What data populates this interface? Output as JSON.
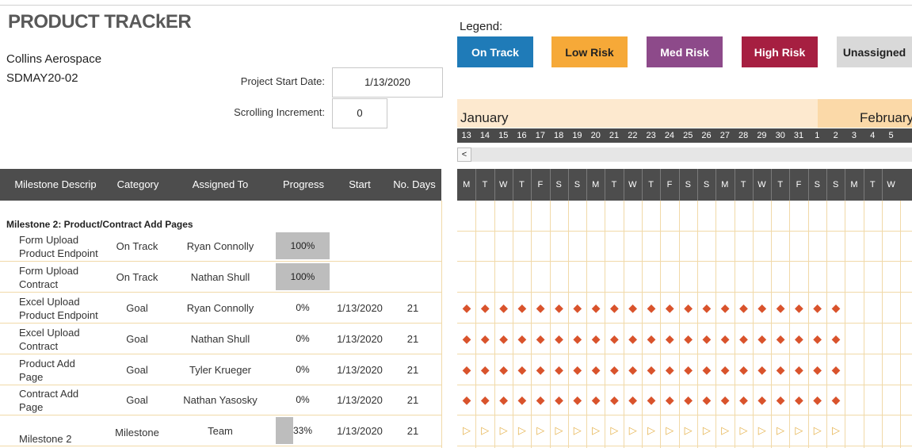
{
  "title": "PRODUCT TRACkER",
  "company": "Collins Aerospace",
  "project_code": "SDMAY20-02",
  "project_start_label": "Project Start Date:",
  "project_start_value": "1/13/2020",
  "scrolling_label": "Scrolling Increment:",
  "scrolling_value": "0",
  "legend": {
    "title": "Legend:",
    "items": [
      {
        "label": "On Track",
        "bg": "#1f7bb8",
        "fg": "#ffffff"
      },
      {
        "label": "Low Risk",
        "bg": "#f6a938",
        "fg": "#222222"
      },
      {
        "label": "Med Risk",
        "bg": "#8d4a8a",
        "fg": "#ffffff"
      },
      {
        "label": "High Risk",
        "bg": "#a61f41",
        "fg": "#ffffff"
      },
      {
        "label": "Unassigned",
        "bg": "#d9d9d9",
        "fg": "#222222"
      }
    ]
  },
  "months": [
    "January",
    "February"
  ],
  "days": [
    "13",
    "14",
    "15",
    "16",
    "17",
    "18",
    "19",
    "20",
    "21",
    "22",
    "23",
    "24",
    "25",
    "26",
    "27",
    "28",
    "29",
    "30",
    "31",
    "1",
    "2",
    "3",
    "4",
    "5"
  ],
  "weekdays": [
    "M",
    "T",
    "W",
    "T",
    "F",
    "S",
    "S",
    "M",
    "T",
    "W",
    "T",
    "F",
    "S",
    "S",
    "M",
    "T",
    "W",
    "T",
    "F",
    "S",
    "S",
    "M",
    "T",
    "W"
  ],
  "scroll_arrow": "<",
  "columns": [
    "Milestone Descrip",
    "Category",
    "Assigned To",
    "Progress",
    "Start",
    "No. Days"
  ],
  "milestone_heading": "Milestone 2: Product/Contract Add Pages",
  "rows": [
    {
      "desc1": "Form Upload",
      "desc2": "Product Endpoint",
      "category": "On Track",
      "assigned": "Ryan Connolly",
      "progress_text": "100%",
      "progress": 1.0,
      "start": "",
      "days": "",
      "marks": 0,
      "mark": "none"
    },
    {
      "desc1": "Form Upload",
      "desc2": "Contract",
      "category": "On Track",
      "assigned": "Nathan Shull",
      "progress_text": "100%",
      "progress": 1.0,
      "start": "",
      "days": "",
      "marks": 0,
      "mark": "none"
    },
    {
      "desc1": "Excel Upload",
      "desc2": "Product Endpoint",
      "category": "Goal",
      "assigned": "Ryan Connolly",
      "progress_text": "0%",
      "progress": 0,
      "start": "1/13/2020",
      "days": "21",
      "marks": 21,
      "mark": "diamond"
    },
    {
      "desc1": "Excel Upload",
      "desc2": "Contract",
      "category": "Goal",
      "assigned": "Nathan Shull",
      "progress_text": "0%",
      "progress": 0,
      "start": "1/13/2020",
      "days": "21",
      "marks": 21,
      "mark": "diamond"
    },
    {
      "desc1": "Product Add",
      "desc2": "Page",
      "category": "Goal",
      "assigned": "Tyler Krueger",
      "progress_text": "0%",
      "progress": 0,
      "start": "1/13/2020",
      "days": "21",
      "marks": 21,
      "mark": "diamond"
    },
    {
      "desc1": "Contract Add",
      "desc2": "Page",
      "category": "Goal",
      "assigned": "Nathan Yasosky",
      "progress_text": "0%",
      "progress": 0,
      "start": "1/13/2020",
      "days": "21",
      "marks": 21,
      "mark": "diamond"
    },
    {
      "desc1": "",
      "desc2": "Milestone 2",
      "category": "Milestone",
      "assigned": "Team",
      "progress_text": "33%",
      "progress": 0.33,
      "start": "1/13/2020",
      "days": "21",
      "marks": 21,
      "mark": "flag"
    }
  ],
  "icons": {
    "diamond": "diamond-icon",
    "flag": "flag-icon"
  }
}
